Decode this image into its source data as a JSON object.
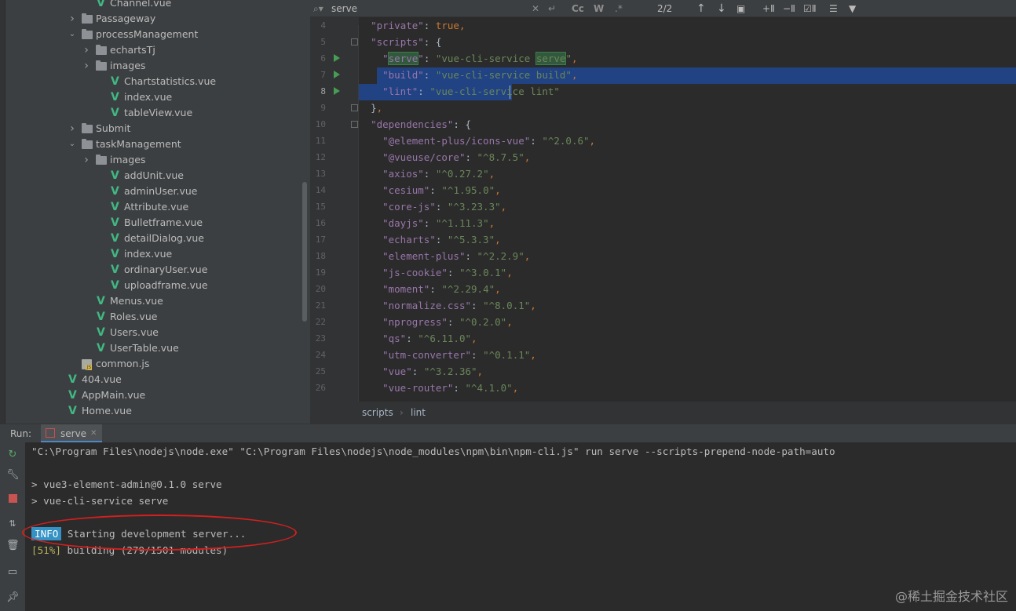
{
  "tree": {
    "items": [
      {
        "label": "Channel.vue",
        "type": "vue"
      },
      {
        "label": "Passageway",
        "type": "folder",
        "state": "collapsed"
      },
      {
        "label": "processManagement",
        "type": "folder",
        "state": "expanded"
      },
      {
        "label": "echartsTj",
        "type": "folder",
        "state": "collapsed"
      },
      {
        "label": "images",
        "type": "folder",
        "state": "collapsed"
      },
      {
        "label": "Chartstatistics.vue",
        "type": "vue"
      },
      {
        "label": "index.vue",
        "type": "vue"
      },
      {
        "label": "tableView.vue",
        "type": "vue"
      },
      {
        "label": "Submit",
        "type": "folder",
        "state": "collapsed"
      },
      {
        "label": "taskManagement",
        "type": "folder",
        "state": "expanded"
      },
      {
        "label": "images",
        "type": "folder",
        "state": "collapsed"
      },
      {
        "label": "addUnit.vue",
        "type": "vue"
      },
      {
        "label": "adminUser.vue",
        "type": "vue"
      },
      {
        "label": "Attribute.vue",
        "type": "vue"
      },
      {
        "label": "Bulletframe.vue",
        "type": "vue"
      },
      {
        "label": "detailDialog.vue",
        "type": "vue"
      },
      {
        "label": "index.vue",
        "type": "vue"
      },
      {
        "label": "ordinaryUser.vue",
        "type": "vue"
      },
      {
        "label": "uploadframe.vue",
        "type": "vue"
      },
      {
        "label": "Menus.vue",
        "type": "vue"
      },
      {
        "label": "Roles.vue",
        "type": "vue"
      },
      {
        "label": "Users.vue",
        "type": "vue"
      },
      {
        "label": "UserTable.vue",
        "type": "vue"
      },
      {
        "label": "common.js",
        "type": "js"
      },
      {
        "label": "404.vue",
        "type": "vue"
      },
      {
        "label": "AppMain.vue",
        "type": "vue"
      },
      {
        "label": "Home.vue",
        "type": "vue"
      }
    ]
  },
  "find": {
    "query": "serve",
    "match_case": "Cc",
    "words": "W",
    "regex": ".*",
    "match_count": "2/2"
  },
  "editor": {
    "lines": [
      {
        "n": "4",
        "text": "  \"private\": true,"
      },
      {
        "n": "5",
        "text": "  \"scripts\": {"
      },
      {
        "n": "6",
        "text": "    \"serve\": \"vue-cli-service serve\","
      },
      {
        "n": "7",
        "text": "    \"build\": \"vue-cli-service build\","
      },
      {
        "n": "8",
        "text": "    \"lint\": \"vue-cli-service lint\""
      },
      {
        "n": "9",
        "text": "  },"
      },
      {
        "n": "10",
        "text": "  \"dependencies\": {"
      },
      {
        "n": "11",
        "text": "    \"@element-plus/icons-vue\": \"^2.0.6\","
      },
      {
        "n": "12",
        "text": "    \"@vueuse/core\": \"^8.7.5\","
      },
      {
        "n": "13",
        "text": "    \"axios\": \"^0.27.2\","
      },
      {
        "n": "14",
        "text": "    \"cesium\": \"^1.95.0\","
      },
      {
        "n": "15",
        "text": "    \"core-js\": \"^3.23.3\","
      },
      {
        "n": "16",
        "text": "    \"dayjs\": \"^1.11.3\","
      },
      {
        "n": "17",
        "text": "    \"echarts\": \"^5.3.3\","
      },
      {
        "n": "18",
        "text": "    \"element-plus\": \"^2.2.9\","
      },
      {
        "n": "19",
        "text": "    \"js-cookie\": \"^3.0.1\","
      },
      {
        "n": "20",
        "text": "    \"moment\": \"^2.29.4\","
      },
      {
        "n": "21",
        "text": "    \"normalize.css\": \"^8.0.1\","
      },
      {
        "n": "22",
        "text": "    \"nprogress\": \"^0.2.0\","
      },
      {
        "n": "23",
        "text": "    \"qs\": \"^6.11.0\","
      },
      {
        "n": "24",
        "text": "    \"utm-converter\": \"^0.1.1\","
      },
      {
        "n": "25",
        "text": "    \"vue\": \"^3.2.36\","
      },
      {
        "n": "26",
        "text": "    \"vue-router\": \"^4.1.0\","
      }
    ],
    "current_line": "8",
    "breadcrumb": [
      "scripts",
      "lint"
    ]
  },
  "run": {
    "title": "Run:",
    "tab_label": "serve",
    "console": {
      "command": "\"C:\\Program Files\\nodejs\\node.exe\" \"C:\\Program Files\\nodejs\\node_modules\\npm\\bin\\npm-cli.js\" run serve --scripts-prepend-node-path=auto",
      "line_pkg": "> vue3-element-admin@0.1.0 serve",
      "line_cli": "> vue-cli-service serve",
      "info_badge": "INFO",
      "info_text": " Starting development server...",
      "progress_pct": "[51%]",
      "progress_text": " building (279/1501 modules)"
    }
  },
  "watermark": "@稀土掘金技术社区",
  "colors": {
    "accent": "#4a88c7",
    "vue_icon": "#41b883",
    "selection": "#214283",
    "info_badge": "#3592c4",
    "annotation_circle": "#d4201e"
  }
}
